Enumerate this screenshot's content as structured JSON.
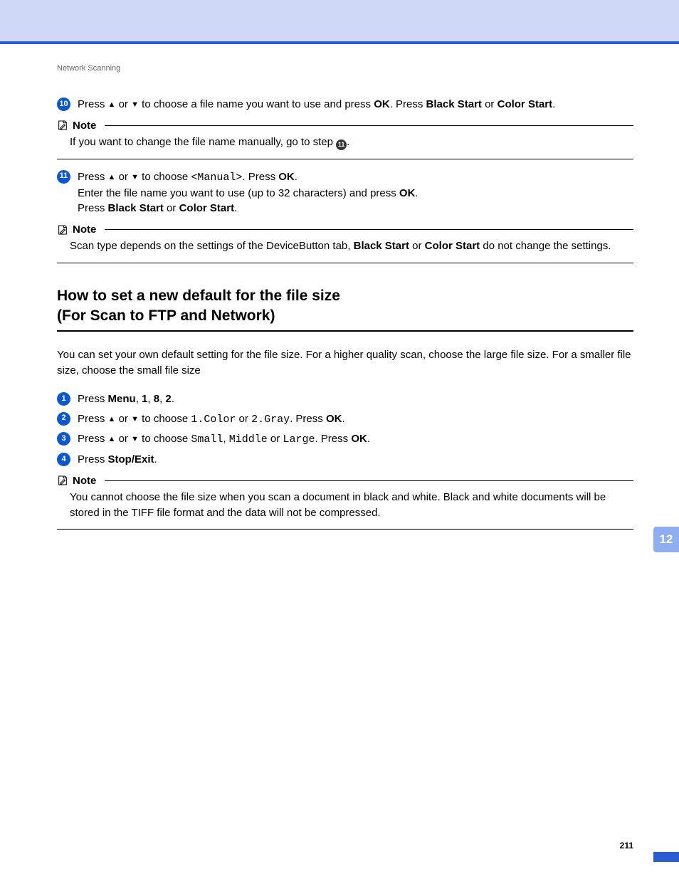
{
  "breadcrumb": "Network Scanning",
  "steps_top": {
    "s10_num": "10",
    "s10_press": "Press ",
    "s10_a": " or ",
    "s10_b": " to choose a file name you want to use and press ",
    "s10_ok": "OK",
    "s10_c": ". Press ",
    "s10_bs": "Black Start",
    "s10_d": " or ",
    "s10_cs": "Color Start",
    "s10_e": "."
  },
  "note1": {
    "label": "Note",
    "t1": "If you want to change the file name manually, go to step ",
    "ref": "11",
    "t2": "."
  },
  "steps_11": {
    "num": "11",
    "l1a": "Press ",
    "l1b": " or ",
    "l1c": " to choose ",
    "manual": "<Manual>",
    "l1d": ". Press ",
    "ok": "OK",
    "l1e": ".",
    "l2a": "Enter the file name you want to use (up to 32 characters) and press ",
    "l2b": ".",
    "l3a": "Press ",
    "bs": "Black Start",
    "l3b": " or ",
    "cs": "Color Start",
    "l3c": "."
  },
  "note2": {
    "label": "Note",
    "t1": "Scan type depends on the settings of the DeviceButton tab, ",
    "bs": "Black Start",
    "t2": " or ",
    "cs": "Color Start",
    "t3": " do not change the settings."
  },
  "h2_l1": "How to set a new default for the file size",
  "h2_l2": "(For Scan to FTP and Network)",
  "intro": "You can set your own default setting for the file size. For a higher quality scan, choose the large file size. For a smaller file size, choose the small file size",
  "s1": {
    "num": "1",
    "a": "Press ",
    "menu": "Menu",
    "b": ", ",
    "n1": "1",
    "n2": "8",
    "n3": "2",
    "c": "."
  },
  "s2": {
    "num": "2",
    "a": "Press ",
    "b": " or ",
    "c": " to choose ",
    "opt1": "1.Color",
    "d": " or ",
    "opt2": "2.Gray",
    "e": ". Press ",
    "ok": "OK",
    "f": "."
  },
  "s3": {
    "num": "3",
    "a": "Press ",
    "b": " or ",
    "c": " to choose ",
    "o1": "Small",
    "d1": ", ",
    "o2": "Middle",
    "d2": " or ",
    "o3": "Large",
    "e": ". Press ",
    "ok": "OK",
    "f": "."
  },
  "s4": {
    "num": "4",
    "a": "Press ",
    "se": "Stop/Exit",
    "b": "."
  },
  "note3": {
    "label": "Note",
    "body": "You cannot choose the file size when you scan a document in black and white. Black and white documents will be stored in the TIFF file format and the data will not be compressed."
  },
  "thumb": "12",
  "page_number": "211"
}
